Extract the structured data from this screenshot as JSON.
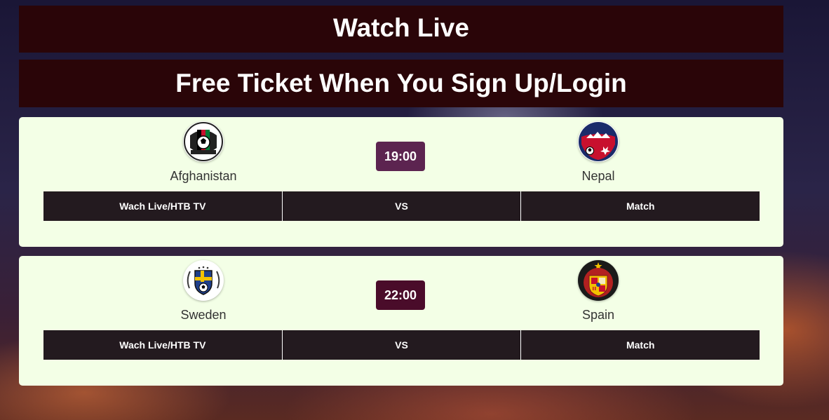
{
  "banners": {
    "title": "Watch Live",
    "subtitle": "Free Ticket When You Sign Up/Login"
  },
  "matches": [
    {
      "home": {
        "name": "Afghanistan",
        "logo_text": "AFGHANISTAN"
      },
      "away": {
        "name": "Nepal",
        "logo_text": "NEPAL"
      },
      "time": "19:00",
      "time_color": "#5c2450",
      "links": {
        "watch": "Wach Live/HTB TV",
        "vs": "VS",
        "match": "Match"
      }
    },
    {
      "home": {
        "name": "Sweden"
      },
      "away": {
        "name": "Spain"
      },
      "time": "22:00",
      "time_color": "#4a0c2a",
      "links": {
        "watch": "Wach Live/HTB TV",
        "vs": "VS",
        "match": "Match"
      }
    }
  ]
}
